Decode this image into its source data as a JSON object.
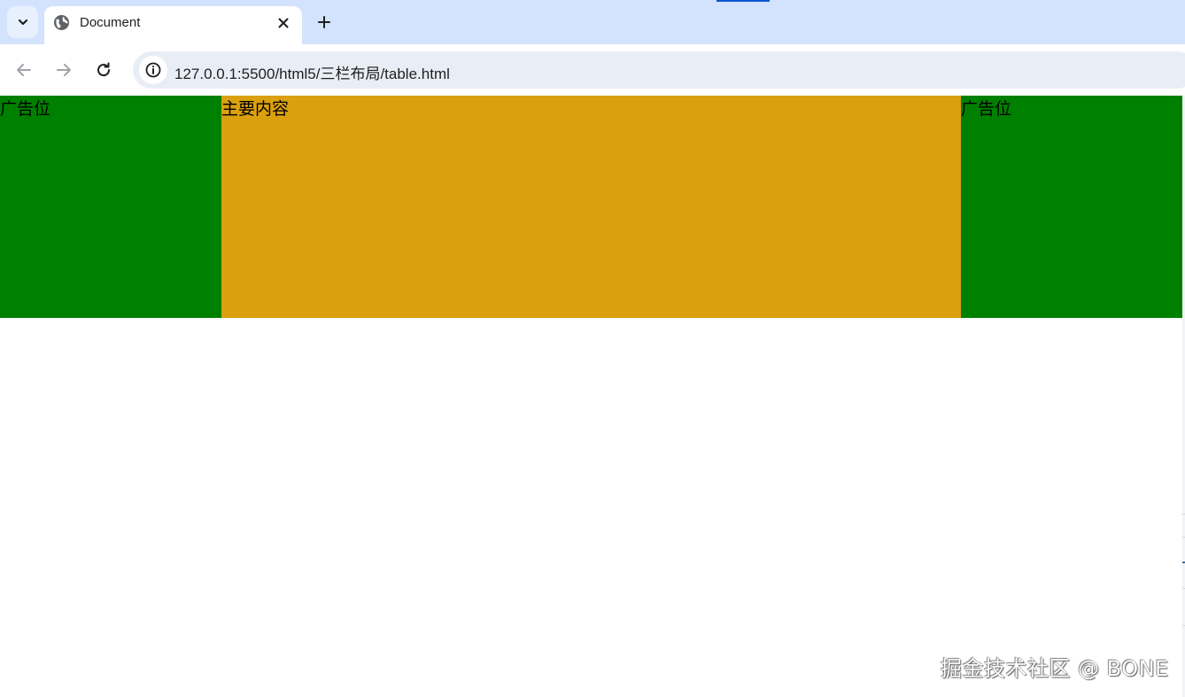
{
  "browser": {
    "tab": {
      "title": "Document"
    },
    "address_bar": {
      "url": "127.0.0.1:5500/html5/三栏布局/table.html"
    }
  },
  "page": {
    "left_cell": {
      "text": "广告位",
      "background": "#008000"
    },
    "main_cell": {
      "text": "主要内容",
      "background": "#daa00e"
    },
    "right_cell": {
      "text": "广告位",
      "background": "#008000"
    }
  },
  "watermark": {
    "text": "掘金技术社区 @ BONE"
  },
  "icons": {
    "tab_search": "chevron-down-icon",
    "favicon": "globe-icon",
    "tab_close": "close-icon",
    "new_tab": "plus-icon",
    "back": "arrow-left-icon",
    "forward": "arrow-right-icon",
    "reload": "reload-icon",
    "site_info": "info-icon"
  }
}
